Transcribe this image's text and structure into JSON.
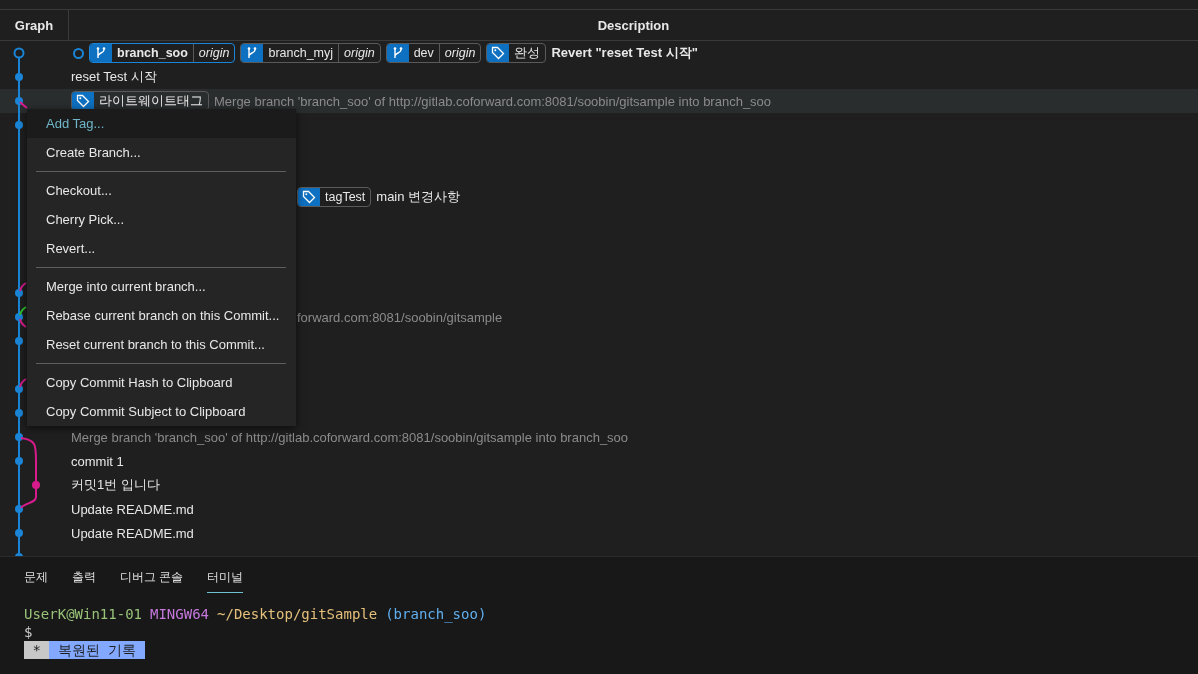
{
  "columns": [
    {
      "label": "Graph"
    },
    {
      "label": "Description"
    }
  ],
  "rows": [
    {
      "kind": "hollow",
      "menu_open": false,
      "dimmed": false,
      "bold": true,
      "head": true,
      "refs": [
        {
          "kind": "branch",
          "name": "branch_soo",
          "remote": "origin",
          "current": true
        },
        {
          "kind": "branch",
          "name": "branch_myj",
          "remote": "origin",
          "current": false
        },
        {
          "kind": "branch",
          "name": "dev",
          "remote": "origin",
          "current": false
        },
        {
          "kind": "tag",
          "name": "완성",
          "current": false
        }
      ],
      "message": "Revert \"reset Test 시작\""
    },
    {
      "kind": "dot",
      "menu_open": false,
      "dimmed": false,
      "bold": false,
      "head": false,
      "message": "reset Test 시작"
    },
    {
      "kind": "dot",
      "menu_open": true,
      "dimmed": true,
      "bold": false,
      "head": false,
      "refs": [
        {
          "kind": "tag",
          "name": "라이트웨이트태그",
          "current": false
        }
      ],
      "message": "Merge branch 'branch_soo' of http://gitlab.coforward.com:8081/soobin/gitsample into branch_soo"
    },
    {
      "kind": "dot",
      "menu_open": false
    },
    {
      "kind": "none",
      "menu_open": false
    },
    {
      "kind": "none",
      "menu_open": false
    },
    {
      "kind": "none",
      "menu_open": false,
      "dimmed": false,
      "bold": false,
      "head": false,
      "refs": [
        {
          "kind": "tag",
          "name": "tagTest",
          "current": false
        }
      ],
      "message": "main 변경사항"
    },
    {
      "kind": "none",
      "menu_open": false
    },
    {
      "kind": "none",
      "menu_open": false
    },
    {
      "kind": "none",
      "menu_open": false
    },
    {
      "kind": "dot",
      "menu_open": false
    },
    {
      "kind": "dot",
      "menu_open": false,
      "dimmed": true,
      "bold": false,
      "head": false,
      "message": "forward.com:8081/soobin/gitsample"
    },
    {
      "kind": "dot",
      "menu_open": false
    },
    {
      "kind": "none",
      "menu_open": false
    },
    {
      "kind": "dot",
      "menu_open": false
    },
    {
      "kind": "dot",
      "menu_open": false
    },
    {
      "kind": "dot",
      "menu_open": false,
      "dimmed": true,
      "bold": false,
      "head": false,
      "message": "Merge branch 'branch_soo' of http://gitlab.coforward.com:8081/soobin/gitsample into branch_soo"
    },
    {
      "kind": "dot",
      "menu_open": false,
      "dimmed": false,
      "bold": false,
      "head": false,
      "message": "commit 1"
    },
    {
      "kind": "side",
      "menu_open": false,
      "dimmed": false,
      "bold": false,
      "head": false,
      "message": "커밋1번 입니다"
    },
    {
      "kind": "dot",
      "menu_open": false,
      "dimmed": false,
      "bold": false,
      "head": false,
      "message": "Update README.md"
    },
    {
      "kind": "dot",
      "menu_open": false,
      "dimmed": false,
      "bold": false,
      "head": false,
      "message": "Update README.md"
    },
    {
      "kind": "dot",
      "menu_open": false
    }
  ],
  "context_menu": [
    [
      {
        "label": "Add Tag...",
        "highlighted": true
      },
      {
        "label": "Create Branch...",
        "highlighted": false
      }
    ],
    [
      {
        "label": "Checkout...",
        "highlighted": false
      },
      {
        "label": "Cherry Pick...",
        "highlighted": false
      },
      {
        "label": "Revert...",
        "highlighted": false
      }
    ],
    [
      {
        "label": "Merge into current branch...",
        "highlighted": false
      },
      {
        "label": "Rebase current branch on this Commit...",
        "highlighted": false
      },
      {
        "label": "Reset current branch to this Commit...",
        "highlighted": false
      }
    ],
    [
      {
        "label": "Copy Commit Hash to Clipboard",
        "highlighted": false
      },
      {
        "label": "Copy Commit Subject to Clipboard",
        "highlighted": false
      }
    ]
  ],
  "panel_tabs": [
    {
      "label": "문제",
      "selected": false
    },
    {
      "label": "출력",
      "selected": false
    },
    {
      "label": "디버그 콘솔",
      "selected": false
    },
    {
      "label": "터미널",
      "selected": true
    }
  ],
  "terminal": [
    [
      {
        "kind": "plain",
        "text": "UserK@Win11-01",
        "color": "#98c379"
      },
      {
        "kind": "plain",
        "text": "MINGW64",
        "color": "#c678dd"
      },
      {
        "kind": "plain",
        "text": "~/Desktop/gitSample",
        "color": "#e5c07b"
      },
      {
        "kind": "plain",
        "text": "(branch_soo)",
        "color": "#61afef"
      }
    ],
    [
      {
        "kind": "plain",
        "text": "$",
        "color": "#cccccc"
      }
    ],
    [
      {
        "kind": "highlighted",
        "text": " * ",
        "color": "#c8c8c8"
      },
      {
        "kind": "highlighted",
        "text": " 복원된 기록 ",
        "color": "#82a8ff"
      }
    ]
  ]
}
